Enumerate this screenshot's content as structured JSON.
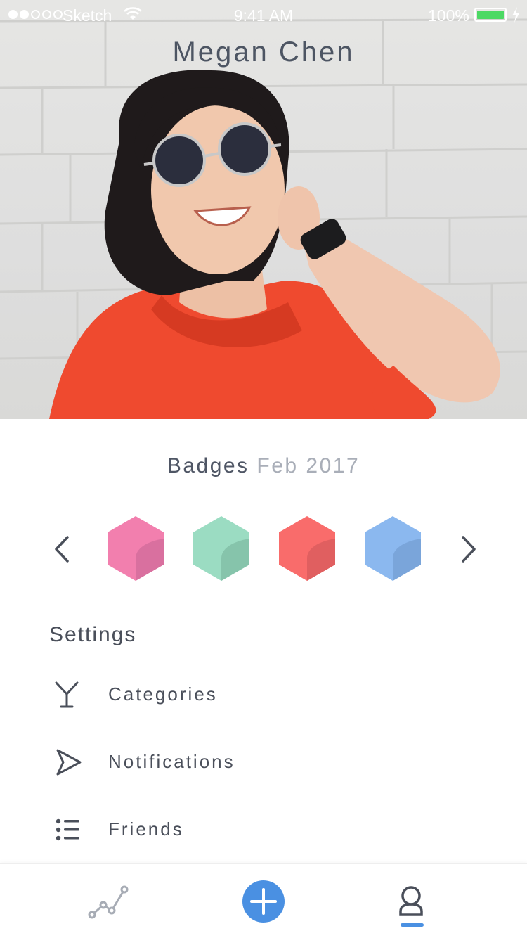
{
  "status_bar": {
    "carrier": "Sketch",
    "time": "9:41 AM",
    "battery": "100%",
    "signal_bars_filled": 2,
    "signal_bars_total": 5
  },
  "profile": {
    "name": "Megan Chen"
  },
  "badges": {
    "label": "Badges",
    "date": "Feb 2017",
    "items": [
      {
        "name": "pink-badge",
        "color": "#f27fae",
        "shade": "#d9709f"
      },
      {
        "name": "mint-badge",
        "color": "#9bdcc2",
        "shade": "#86c4ab"
      },
      {
        "name": "coral-badge",
        "color": "#f96c6b",
        "shade": "#e05f60"
      },
      {
        "name": "blue-badge",
        "color": "#8bb8ef",
        "shade": "#7aa5da"
      }
    ]
  },
  "settings": {
    "title": "Settings",
    "items": [
      {
        "label": "Categories",
        "icon": "cocktail-glass-icon"
      },
      {
        "label": "Notifications",
        "icon": "send-arrow-icon"
      },
      {
        "label": "Friends",
        "icon": "list-icon"
      }
    ]
  },
  "tab_bar": {
    "tabs": [
      {
        "name": "stats",
        "icon": "line-chart-icon"
      },
      {
        "name": "add",
        "icon": "plus-circle-icon"
      },
      {
        "name": "profile",
        "icon": "user-icon"
      }
    ],
    "active": "profile"
  },
  "colors": {
    "accent": "#4a90e2",
    "text": "#4a4f5a",
    "muted": "#a9aeb8",
    "battery": "#4cd964"
  }
}
